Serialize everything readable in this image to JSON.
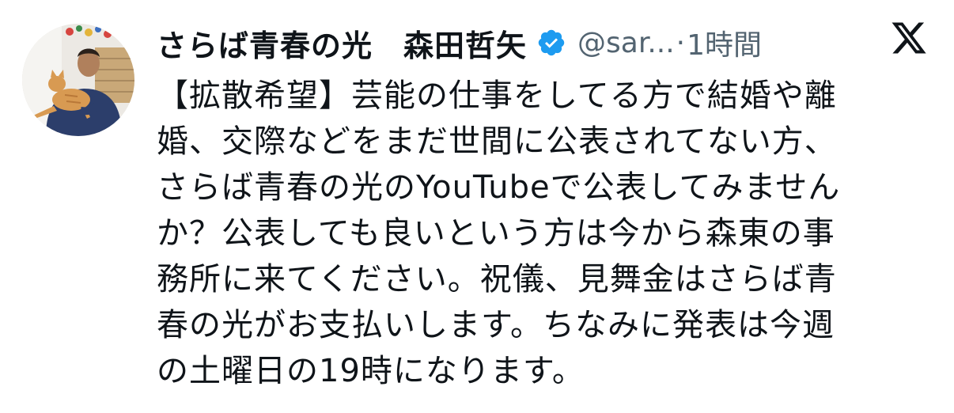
{
  "author": {
    "display_name": "さらば青春の光　森田哲矢",
    "handle": "@sar...",
    "separator": "·",
    "time": "1時間",
    "verified_color": "#1d9bf0"
  },
  "tweet": {
    "lines": [
      "【拡散希望】芸能の仕事をしてる方で結婚や離",
      "婚、交際などをまだ世間に公表されてない方、",
      "さらば青春の光のYouTubeで公表してみません",
      "か？公表しても良いという方は今から森東の事",
      "務所に来てください。祝儀、見舞金はさらば青",
      "春の光がお支払いします。ちなみに発表は今週",
      "の土曜日の19時になります。"
    ]
  },
  "icons": {
    "avatar": "profile-photo",
    "verified": "verified-badge-icon",
    "platform": "x-logo-icon"
  }
}
